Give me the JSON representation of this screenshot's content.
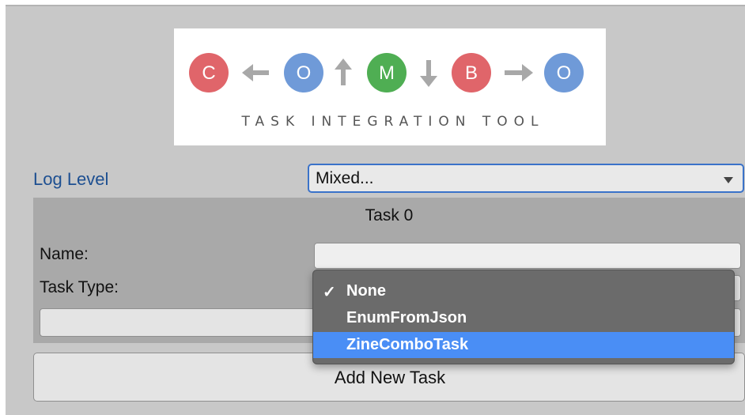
{
  "logo": {
    "letters": [
      "C",
      "O",
      "M",
      "B",
      "O"
    ],
    "colors": [
      "#e0656a",
      "#6f9ad8",
      "#4fae53",
      "#e0656a",
      "#6f9ad8"
    ],
    "arrow_icons": [
      "arrow-left-icon",
      "arrow-up-icon",
      "arrow-down-icon",
      "arrow-right-icon"
    ],
    "subtitle": "TASK INTEGRATION TOOL"
  },
  "log_level": {
    "label": "Log Level",
    "value": "Mixed..."
  },
  "task": {
    "header": "Task 0",
    "name_label": "Name:",
    "name_value": "",
    "type_label": "Task Type:"
  },
  "dropdown": {
    "check": "✓",
    "options": [
      "None",
      "EnumFromJson",
      "ZineComboTask"
    ],
    "selected": "None",
    "highlighted": "ZineComboTask"
  },
  "add_task": {
    "label": "Add New Task"
  },
  "colors": {
    "accent": "#3a72c9",
    "highlight": "#4a8ef5",
    "label_blue": "#1d4f91"
  }
}
